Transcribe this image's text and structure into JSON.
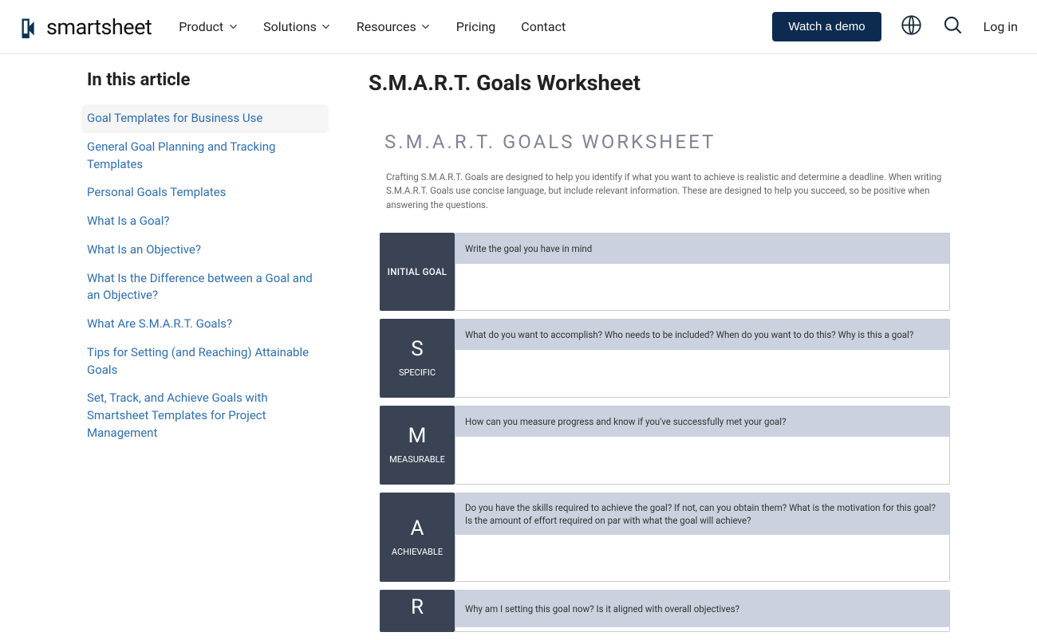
{
  "header": {
    "logo_text": "smartsheet",
    "nav": {
      "product": "Product",
      "solutions": "Solutions",
      "resources": "Resources",
      "pricing": "Pricing",
      "contact": "Contact"
    },
    "demo_button": "Watch a demo",
    "login": "Log in"
  },
  "sidebar": {
    "title": "In this article",
    "items": [
      {
        "label": "Goal Templates for Business Use",
        "active": true
      },
      {
        "label": "General Goal Planning and Tracking Templates",
        "active": false
      },
      {
        "label": "Personal Goals Templates",
        "active": false
      },
      {
        "label": "What Is a Goal?",
        "active": false
      },
      {
        "label": "What Is an Objective?",
        "active": false
      },
      {
        "label": "What Is the Difference between a Goal and an Objective?",
        "active": false
      },
      {
        "label": "What Are S.M.A.R.T. Goals?",
        "active": false
      },
      {
        "label": "Tips for Setting (and Reaching) Attainable Goals",
        "active": false
      },
      {
        "label": "Set, Track, and Achieve Goals with Smartsheet Templates for Project Management",
        "active": false
      }
    ]
  },
  "content": {
    "title": "S.M.A.R.T. Goals Worksheet",
    "worksheet": {
      "heading": "S.M.A.R.T. GOALS WORKSHEET",
      "intro": "Crafting S.M.A.R.T. Goals are designed to help you identify if what you want to achieve is realistic and determine a deadline. When writing S.M.A.R.T. Goals use concise language, but include relevant information. These are designed to help you succeed, so be positive when answering the questions.",
      "rows": [
        {
          "letter": "",
          "label": "INITIAL GOAL",
          "prompt": "Write the goal you have in mind",
          "class": "h-initial",
          "labelClass": "initial"
        },
        {
          "letter": "S",
          "label": "SPECIFIC",
          "prompt": "What do you want to accomplish? Who needs to be included? When do you want to do this? Why is this a goal?",
          "class": "h-specific",
          "labelClass": ""
        },
        {
          "letter": "M",
          "label": "MEASURABLE",
          "prompt": "How can you measure progress and know if you've successfully met your goal?",
          "class": "h-measurable",
          "labelClass": ""
        },
        {
          "letter": "A",
          "label": "ACHIEVABLE",
          "prompt": "Do you have the skills required to achieve the goal? If not, can you obtain them? What is the motivation for this goal? Is the amount of effort required on par with what the goal will achieve?",
          "class": "h-achievable",
          "labelClass": ""
        },
        {
          "letter": "R",
          "label": "",
          "prompt": "Why am I setting this goal now? Is it aligned with overall objectives?",
          "class": "h-relevant",
          "labelClass": ""
        }
      ]
    }
  }
}
